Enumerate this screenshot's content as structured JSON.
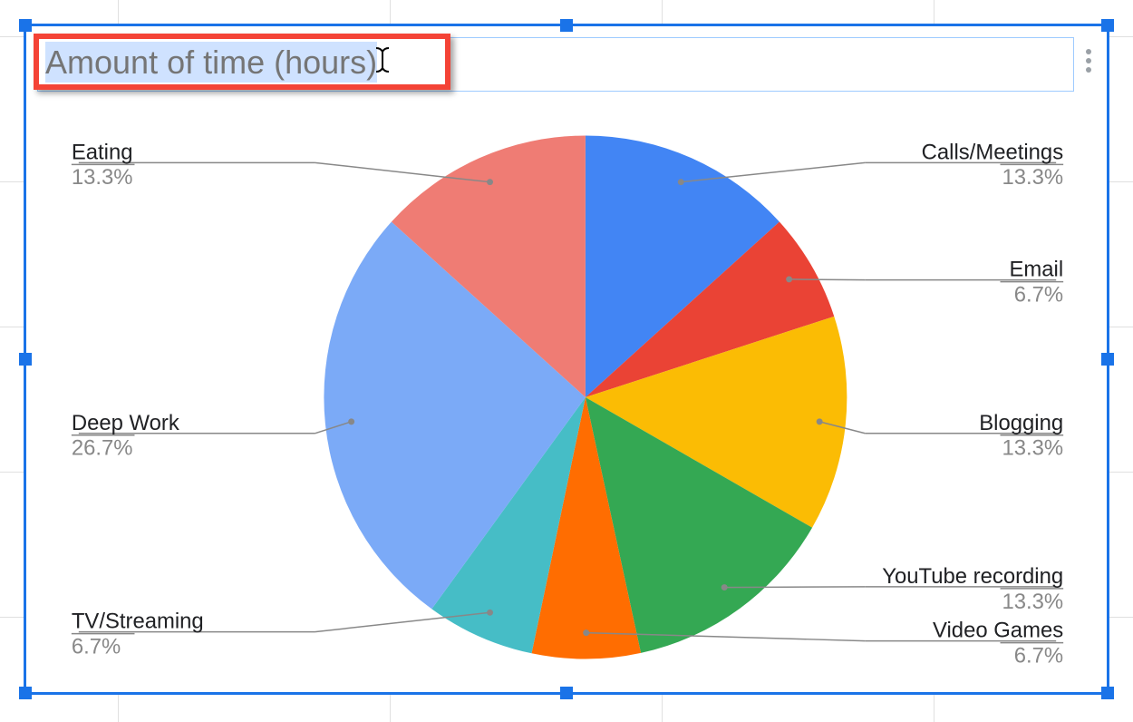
{
  "title": "Amount of time (hours)",
  "chart_data": {
    "type": "pie",
    "title": "Amount of time (hours)",
    "series": [
      {
        "name": "Calls/Meetings",
        "percent": 13.3,
        "color": "#4285f4"
      },
      {
        "name": "Email",
        "percent": 6.7,
        "color": "#ea4335"
      },
      {
        "name": "Blogging",
        "percent": 13.3,
        "color": "#fbbc04"
      },
      {
        "name": "YouTube recording",
        "percent": 13.3,
        "color": "#34a853"
      },
      {
        "name": "Video Games",
        "percent": 6.7,
        "color": "#ff6d01"
      },
      {
        "name": "TV/Streaming",
        "percent": 6.7,
        "color": "#46bdc6"
      },
      {
        "name": "Deep Work",
        "percent": 26.7,
        "color": "#7baaf7"
      },
      {
        "name": "Eating",
        "percent": 13.3,
        "color": "#ef7c74"
      }
    ],
    "labels_left": [
      {
        "name": "Eating",
        "pct": "13.3%",
        "slice": 7
      },
      {
        "name": "Deep Work",
        "pct": "26.7%",
        "slice": 6
      },
      {
        "name": "TV/Streaming",
        "pct": "6.7%",
        "slice": 5
      }
    ],
    "labels_right": [
      {
        "name": "Calls/Meetings",
        "pct": "13.3%",
        "slice": 0
      },
      {
        "name": "Email",
        "pct": "6.7%",
        "slice": 1
      },
      {
        "name": "Blogging",
        "pct": "13.3%",
        "slice": 2
      },
      {
        "name": "YouTube recording",
        "pct": "13.3%",
        "slice": 3
      },
      {
        "name": "Video Games",
        "pct": "6.7%",
        "slice": 4
      }
    ]
  }
}
